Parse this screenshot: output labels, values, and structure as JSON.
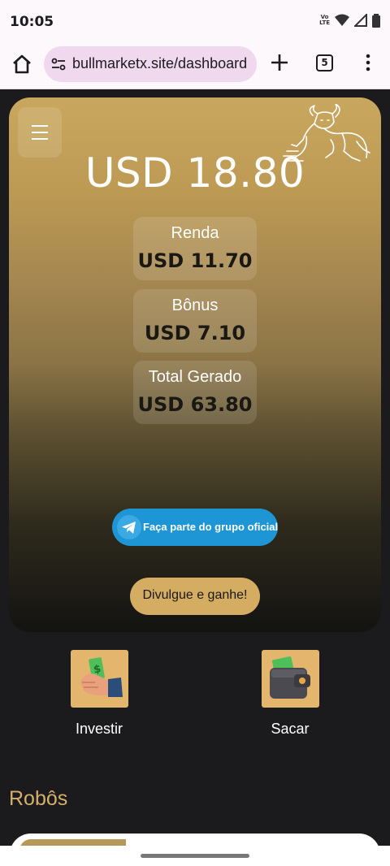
{
  "status_bar": {
    "time": "10:05",
    "network_label": "Vo)) LTE"
  },
  "browser": {
    "url": "bullmarketx.site/dashboard",
    "tab_count": "5"
  },
  "dashboard": {
    "balance": "USD 18.80",
    "stats": [
      {
        "label": "Renda",
        "value": "USD 11.70"
      },
      {
        "label": "Bônus",
        "value": "USD 7.10"
      },
      {
        "label": "Total Gerado",
        "value": "USD 63.80"
      }
    ],
    "telegram_label": "Faça parte do grupo oficial",
    "share_label": "Divulgue e ganhe!"
  },
  "actions": [
    {
      "label": "Investir",
      "icon": "hand-money-icon"
    },
    {
      "label": "Sacar",
      "icon": "wallet-icon"
    }
  ],
  "robos": {
    "title": "Robôs"
  },
  "colors": {
    "gold": "#d4ad63",
    "telegram": "#1e96d5",
    "background": "#1b1a1c"
  }
}
